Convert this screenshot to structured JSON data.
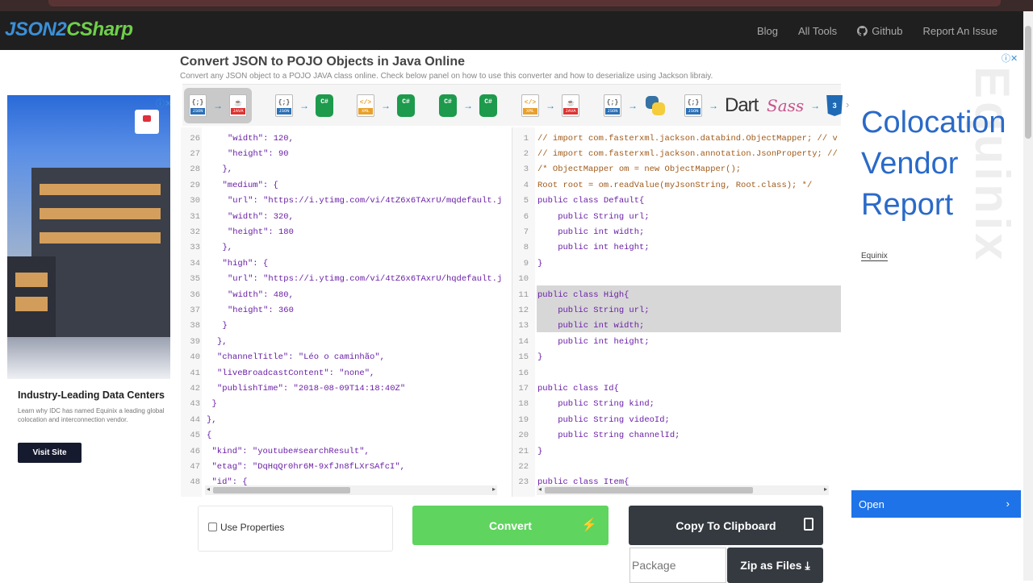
{
  "navbar": {
    "logo_part1": "JSON2",
    "logo_part2": "CSharp",
    "links": [
      "Blog",
      "All Tools",
      "Github",
      "Report An Issue"
    ]
  },
  "header": {
    "title": "Convert JSON to POJO Objects in Java Online",
    "subtitle": "Convert any JSON object to a POJO JAVA class online. Check below panel on how to use this converter and how to deserialize using Jackson libraiy."
  },
  "toolbar": {
    "items": [
      {
        "name": "json-to-java",
        "from": "JSON",
        "to": "JAVA",
        "active": true
      },
      {
        "name": "json-to-csharp",
        "from": "JSON",
        "to": "C#"
      },
      {
        "name": "xml-to-csharp",
        "from": "XML",
        "to": "C#"
      },
      {
        "name": "csharp-to-json",
        "from": "C#",
        "to": "{}"
      },
      {
        "name": "xml-to-java",
        "from": "XML",
        "to": "JAVA"
      },
      {
        "name": "json-to-python",
        "from": "JSON",
        "to": "Python"
      },
      {
        "name": "json-to-dart",
        "from": "JSON",
        "to": "Dart"
      },
      {
        "name": "sass-to-css",
        "from": "Sass",
        "to": "CSS3"
      }
    ],
    "file_labels": {
      "json": "JSON",
      "java": "JAVA",
      "xml": "XML",
      "cs": "C#",
      "css": "3"
    }
  },
  "left_editor": {
    "lines": [
      {
        "n": "26",
        "indent": 8,
        "text": "\"width\": 120,"
      },
      {
        "n": "27",
        "indent": 8,
        "text": "\"height\": 90"
      },
      {
        "n": "28",
        "indent": 7,
        "text": "},"
      },
      {
        "n": "29",
        "indent": 7,
        "text": "\"medium\": {"
      },
      {
        "n": "30",
        "indent": 8,
        "text": "\"url\": \"https://i.ytimg.com/vi/4tZ6x6TAxrU/mqdefault.j"
      },
      {
        "n": "31",
        "indent": 8,
        "text": "\"width\": 320,"
      },
      {
        "n": "32",
        "indent": 8,
        "text": "\"height\": 180"
      },
      {
        "n": "33",
        "indent": 7,
        "text": "},"
      },
      {
        "n": "34",
        "indent": 7,
        "text": "\"high\": {"
      },
      {
        "n": "35",
        "indent": 8,
        "text": "\"url\": \"https://i.ytimg.com/vi/4tZ6x6TAxrU/hqdefault.j"
      },
      {
        "n": "36",
        "indent": 8,
        "text": "\"width\": 480,"
      },
      {
        "n": "37",
        "indent": 8,
        "text": "\"height\": 360"
      },
      {
        "n": "38",
        "indent": 7,
        "text": "}"
      },
      {
        "n": "39",
        "indent": 6,
        "text": "},"
      },
      {
        "n": "40",
        "indent": 6,
        "text": "\"channelTitle\": \"Léo o caminhão\","
      },
      {
        "n": "41",
        "indent": 6,
        "text": "\"liveBroadcastContent\": \"none\","
      },
      {
        "n": "42",
        "indent": 6,
        "text": "\"publishTime\": \"2018-08-09T14:18:40Z\""
      },
      {
        "n": "43",
        "indent": 5,
        "text": "}"
      },
      {
        "n": "44",
        "indent": 4,
        "text": "},"
      },
      {
        "n": "45",
        "indent": 4,
        "text": "{"
      },
      {
        "n": "46",
        "indent": 5,
        "text": "\"kind\": \"youtube#searchResult\","
      },
      {
        "n": "47",
        "indent": 5,
        "text": "\"etag\": \"DqHqQr0hr6M-9xfJn8fLXrSAfcI\","
      },
      {
        "n": "48",
        "indent": 5,
        "text": "\"id\": {"
      }
    ]
  },
  "right_editor": {
    "lines": [
      {
        "n": "1",
        "text": "// import com.fasterxml.jackson.databind.ObjectMapper; // v"
      },
      {
        "n": "2",
        "text": "// import com.fasterxml.jackson.annotation.JsonProperty; //"
      },
      {
        "n": "3",
        "text": "/* ObjectMapper om = new ObjectMapper();"
      },
      {
        "n": "4",
        "text": "Root root = om.readValue(myJsonString, Root.class); */"
      },
      {
        "n": "5",
        "text": "public class Default{"
      },
      {
        "n": "6",
        "text": "    public String url;"
      },
      {
        "n": "7",
        "text": "    public int width;"
      },
      {
        "n": "8",
        "text": "    public int height;"
      },
      {
        "n": "9",
        "text": "}"
      },
      {
        "n": "10",
        "text": ""
      },
      {
        "n": "11",
        "text": "public class High{"
      },
      {
        "n": "12",
        "text": "    public String url;"
      },
      {
        "n": "13",
        "text": "    public int width;"
      },
      {
        "n": "14",
        "text": "    public int height;"
      },
      {
        "n": "15",
        "text": "}"
      },
      {
        "n": "16",
        "text": ""
      },
      {
        "n": "17",
        "text": "public class Id{"
      },
      {
        "n": "18",
        "text": "    public String kind;"
      },
      {
        "n": "19",
        "text": "    public String videoId;"
      },
      {
        "n": "20",
        "text": "    public String channelId;"
      },
      {
        "n": "21",
        "text": "}"
      },
      {
        "n": "22",
        "text": ""
      },
      {
        "n": "23",
        "text": "public class Item{"
      }
    ]
  },
  "controls": {
    "use_properties_label": "Use Properties",
    "convert_label": "Convert",
    "copy_label": "Copy To Clipboard",
    "package_placeholder": "Package",
    "zip_label": "Zip as Files"
  },
  "ad_left": {
    "title": "Industry-Leading Data Centers",
    "description": "Learn why IDC has named Equinix a leading global colocation and interconnection vendor.",
    "button": "Visit Site"
  },
  "ad_right": {
    "title_lines": [
      "Colocation",
      "Vendor",
      "Report"
    ],
    "brand": "Equinix",
    "watermark": "Equinix",
    "open_label": "Open"
  },
  "colors": {
    "convert": "#5fd45f",
    "dark_button": "#343a40",
    "logo_blue": "#3b8fd8",
    "logo_green": "#6fcf4a",
    "ad_blue": "#1e73e8"
  }
}
